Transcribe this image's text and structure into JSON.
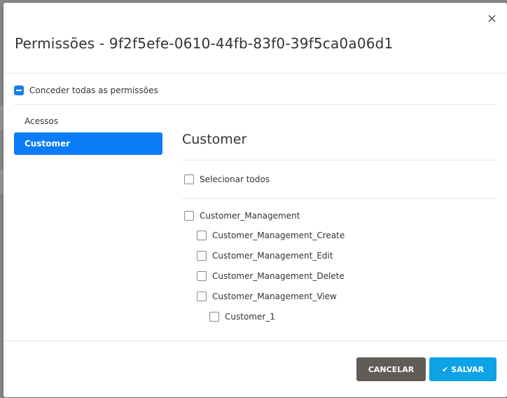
{
  "modal": {
    "title": "Permissões - 9f2f5efe-0610-44fb-83f0-39f5ca0a06d1",
    "close_label": "×"
  },
  "grant_all": {
    "label": "Conceder todas as permissões",
    "state": "indeterminate"
  },
  "sidebar": {
    "items": [
      {
        "label": "Acessos",
        "active": false
      },
      {
        "label": "Customer",
        "active": true
      }
    ]
  },
  "content": {
    "section_title": "Customer",
    "select_all_label": "Selecionar todos",
    "permissions": [
      {
        "label": "Customer_Management",
        "checked": false
      },
      {
        "label": "Customer_Management_Create",
        "checked": false
      },
      {
        "label": "Customer_Management_Edit",
        "checked": false
      },
      {
        "label": "Customer_Management_Delete",
        "checked": false
      },
      {
        "label": "Customer_Management_View",
        "checked": false
      },
      {
        "label": "Customer_1",
        "checked": false
      }
    ]
  },
  "footer": {
    "cancel_label": "CANCELAR",
    "save_label": "SALVAR",
    "save_icon": "check-icon"
  },
  "colors": {
    "primary": "#0a7cf5",
    "save": "#0ea2e6",
    "cancel": "#615c56"
  }
}
